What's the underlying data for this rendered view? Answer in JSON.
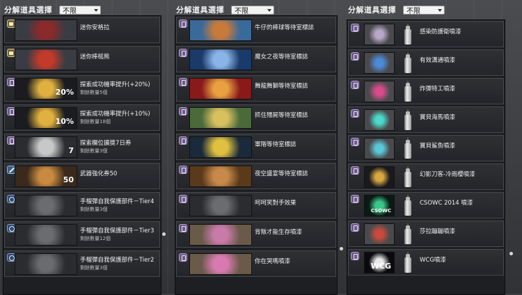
{
  "panels": [
    {
      "title": "分解道具選擇",
      "filter": "不限",
      "items": [
        {
          "tag": "shirt",
          "tag_icon": "shirt-icon",
          "name": "迷你安格拉",
          "sub": "",
          "thumb_colors": [
            "#3a3c44",
            "#8a2a2a"
          ]
        },
        {
          "tag": "shirt",
          "tag_icon": "shirt-icon",
          "name": "迷你棒槌熊",
          "sub": "",
          "thumb_colors": [
            "#3a3c44",
            "#c23a2a"
          ]
        },
        {
          "tag": "doc",
          "tag_icon": "document-icon",
          "name": "探索成功機率提升(+20%)",
          "sub": "剩餘數量5個",
          "thumb_text": "20%",
          "thumb_colors": [
            "#1a1c20",
            "#e0b040"
          ]
        },
        {
          "tag": "doc",
          "tag_icon": "document-icon",
          "name": "探索成功機率提升(+10%)",
          "sub": "剩餘數量18個",
          "thumb_text": "10%",
          "thumb_colors": [
            "#1a1c20",
            "#e0b040"
          ]
        },
        {
          "tag": "doc",
          "tag_icon": "document-icon",
          "name": "探索欄位擴獎7日券",
          "sub": "剩餘數量3個",
          "thumb_text": "7",
          "thumb_colors": [
            "#2a2c30",
            "#c8c8c8"
          ]
        },
        {
          "tag": "wrench",
          "tag_icon": "wrench-icon",
          "name": "武器強化券50",
          "sub": "",
          "thumb_text": "50",
          "thumb_colors": [
            "#3a2a1c",
            "#c88a40"
          ]
        },
        {
          "tag": "gear",
          "tag_icon": "gear-icon",
          "name": "手榴彈自我保護部件－Tier4",
          "sub": "剩餘數量3個",
          "thumb_colors": [
            "#2a2c30",
            "#6a6c70"
          ]
        },
        {
          "tag": "gear",
          "tag_icon": "gear-icon",
          "name": "手榴彈自我保護部件－Tier3",
          "sub": "剩餘數量12個",
          "thumb_colors": [
            "#2a2c30",
            "#6a6c70"
          ]
        },
        {
          "tag": "gear",
          "tag_icon": "gear-icon",
          "name": "手榴彈自我保護部件－Tier2",
          "sub": "剩餘數量3個",
          "thumb_colors": [
            "#2a2c30",
            "#6a6c70"
          ]
        }
      ]
    },
    {
      "title": "分解道具選擇",
      "filter": "不限",
      "items": [
        {
          "tag": "doc",
          "tag_icon": "document-icon",
          "name": "牛仔的棒球等待室標誌",
          "thumb_colors": [
            "#3a6a9a",
            "#c87a3a"
          ]
        },
        {
          "tag": "doc",
          "tag_icon": "document-icon",
          "name": "魔女之夜等待室標誌",
          "thumb_colors": [
            "#1a3a6a",
            "#8ab4e8"
          ]
        },
        {
          "tag": "doc",
          "tag_icon": "document-icon",
          "name": "舞龍舞獅等待室標誌",
          "thumb_colors": [
            "#8a1a1a",
            "#e8a040"
          ]
        },
        {
          "tag": "doc",
          "tag_icon": "document-icon",
          "name": "抓住殭屍等待室標誌",
          "thumb_colors": [
            "#4a6a3a",
            "#d8c060"
          ]
        },
        {
          "tag": "doc",
          "tag_icon": "document-icon",
          "name": "軍階等待室標誌",
          "thumb_colors": [
            "#1a2a3a",
            "#e0c040"
          ]
        },
        {
          "tag": "doc",
          "tag_icon": "document-icon",
          "name": "夜空盛宴等待室標誌",
          "thumb_colors": [
            "#5a3a1a",
            "#c88a4a"
          ]
        },
        {
          "tag": "doc",
          "tag_icon": "document-icon",
          "name": "呵呵笑對手效果",
          "thumb_colors": [
            "#2a2c30",
            "#6a6c70"
          ]
        },
        {
          "tag": "doc",
          "tag_icon": "document-icon",
          "name": "背叛才能生存噴漆",
          "thumb_colors": [
            "#6a5a4a",
            "#c87aa8"
          ]
        },
        {
          "tag": "doc",
          "tag_icon": "document-icon",
          "name": "你在哭嗎噴漆",
          "thumb_colors": [
            "#6a5a4a",
            "#d87ab0"
          ]
        }
      ]
    },
    {
      "title": "分解道具選擇",
      "filter": "不限",
      "items": [
        {
          "tag": "doc",
          "tag_icon": "document-icon",
          "name": "感染防護衛噴漆",
          "thumb_colors": [
            "#4a4a4e",
            "#b8a8c8"
          ]
        },
        {
          "tag": "doc",
          "tag_icon": "document-icon",
          "name": "有效溝通噴漆",
          "thumb_colors": [
            "#4a4a4e",
            "#4a8ad8"
          ]
        },
        {
          "tag": "doc",
          "tag_icon": "document-icon",
          "name": "炸彈特工噴漆",
          "thumb_colors": [
            "#4a4a4e",
            "#d84a8a"
          ]
        },
        {
          "tag": "doc",
          "tag_icon": "document-icon",
          "name": "寶貝海馬噴漆",
          "thumb_colors": [
            "#4a4a4e",
            "#4ad8c8"
          ]
        },
        {
          "tag": "doc",
          "tag_icon": "document-icon",
          "name": "寶貝鯊魚噴漆",
          "thumb_colors": [
            "#4a4a4e",
            "#5ac8d8"
          ]
        },
        {
          "tag": "doc",
          "tag_icon": "document-icon",
          "name": "幻影刀客-冷雨櫻噴漆",
          "thumb_colors": [
            "#1a1a1e",
            "#d8a840"
          ]
        },
        {
          "tag": "doc",
          "tag_icon": "document-icon",
          "name": "CSOWC 2014 噴漆",
          "thumb_text": "CSOWC",
          "thumb_colors": [
            "#0a1a14",
            "#3ac88a"
          ]
        },
        {
          "tag": "doc",
          "tag_icon": "document-icon",
          "name": "莎拉蹦蹦噴漆",
          "thumb_colors": [
            "#4a4a4e",
            "#c84a3a"
          ]
        },
        {
          "tag": "doc",
          "tag_icon": "document-icon",
          "name": "WCG噴漆",
          "thumb_text": "WCG",
          "thumb_colors": [
            "#0a0a0e",
            "#e8e8e8"
          ]
        }
      ]
    }
  ]
}
